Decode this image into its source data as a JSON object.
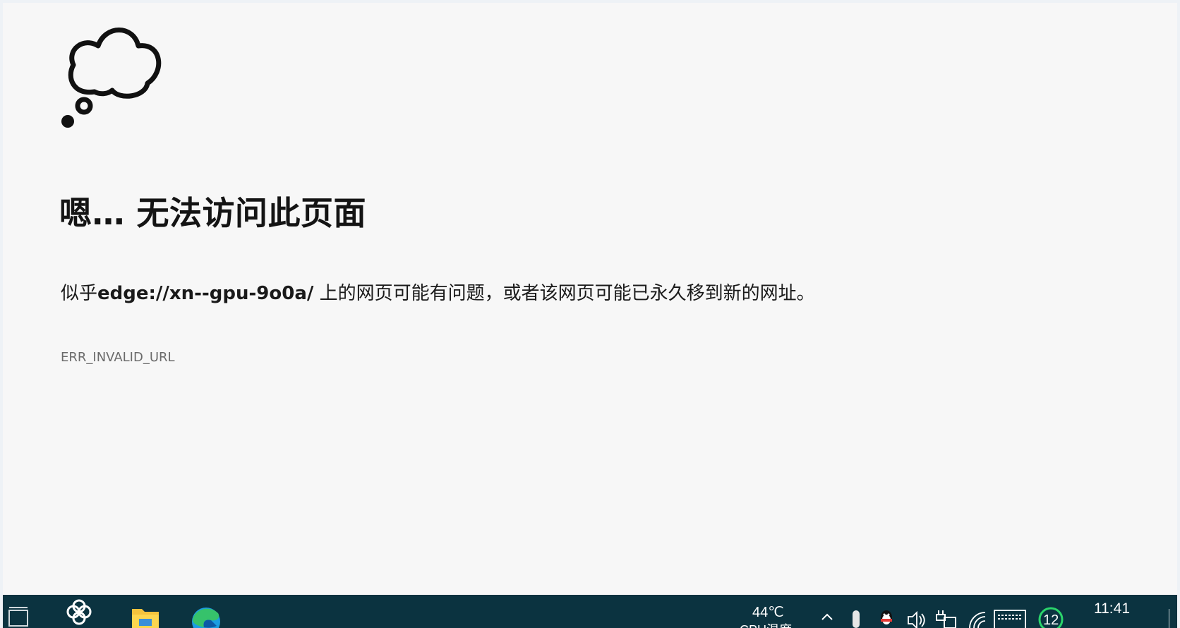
{
  "error_page": {
    "title": "嗯… 无法访问此页面",
    "message_prefix": "似乎",
    "url": "edge://xn--gpu-9o0a/",
    "message_suffix": " 上的网页可能有问题，或者该网页可能已永久移到新的网址。",
    "error_code": "ERR_INVALID_URL",
    "icon": "thought-cloud-icon"
  },
  "taskbar": {
    "background": "#0b3340",
    "items": [
      {
        "name": "task-view-icon"
      },
      {
        "name": "app-pinwheel-icon"
      },
      {
        "name": "file-explorer-icon"
      },
      {
        "name": "edge-browser-icon"
      }
    ],
    "tray": {
      "temperature": "44℃",
      "temperature_label": "CPU温度",
      "notification_count": "12",
      "time": "11:41",
      "icons": [
        "chevron-up-icon",
        "microphone-icon",
        "qq-icon",
        "volume-icon",
        "power-plug-icon",
        "wifi-icon",
        "keyboard-icon",
        "notification-badge-icon"
      ]
    }
  }
}
